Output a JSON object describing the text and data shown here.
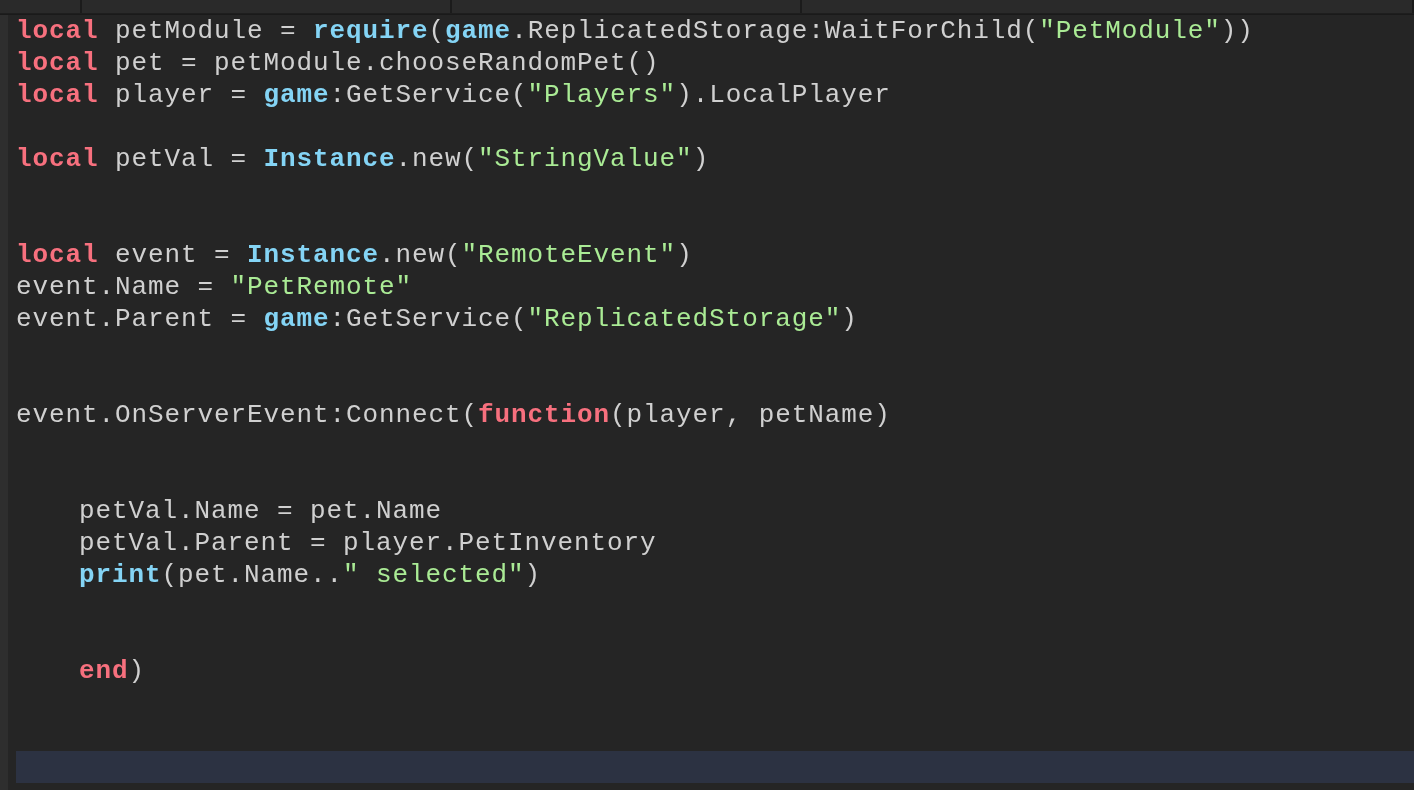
{
  "lines": [
    {
      "kind": "code",
      "current": false,
      "tokens": [
        {
          "kind": "kw",
          "s": "local"
        },
        {
          "kind": "p",
          "s": " petModule = "
        },
        {
          "kind": "bi",
          "s": "require"
        },
        {
          "kind": "p",
          "s": "("
        },
        {
          "kind": "bi",
          "s": "game"
        },
        {
          "kind": "p",
          "s": ".ReplicatedStorage:WaitForChild("
        },
        {
          "kind": "str",
          "s": "\"PetModule\""
        },
        {
          "kind": "p",
          "s": "))"
        }
      ]
    },
    {
      "kind": "code",
      "current": false,
      "tokens": [
        {
          "kind": "kw",
          "s": "local"
        },
        {
          "kind": "p",
          "s": " pet = petModule.chooseRandomPet()"
        }
      ]
    },
    {
      "kind": "code",
      "current": false,
      "tokens": [
        {
          "kind": "kw",
          "s": "local"
        },
        {
          "kind": "p",
          "s": " player = "
        },
        {
          "kind": "bi",
          "s": "game"
        },
        {
          "kind": "p",
          "s": ":GetService("
        },
        {
          "kind": "str",
          "s": "\"Players\""
        },
        {
          "kind": "p",
          "s": ").LocalPlayer"
        }
      ]
    },
    {
      "kind": "blank",
      "current": false
    },
    {
      "kind": "code",
      "current": false,
      "tokens": [
        {
          "kind": "kw",
          "s": "local"
        },
        {
          "kind": "p",
          "s": " petVal = "
        },
        {
          "kind": "bi",
          "s": "Instance"
        },
        {
          "kind": "p",
          "s": ".new("
        },
        {
          "kind": "str",
          "s": "\"StringValue\""
        },
        {
          "kind": "p",
          "s": ")"
        }
      ]
    },
    {
      "kind": "blank",
      "current": false
    },
    {
      "kind": "blank",
      "current": false
    },
    {
      "kind": "code",
      "current": false,
      "tokens": [
        {
          "kind": "kw",
          "s": "local"
        },
        {
          "kind": "p",
          "s": " event = "
        },
        {
          "kind": "bi",
          "s": "Instance"
        },
        {
          "kind": "p",
          "s": ".new("
        },
        {
          "kind": "str",
          "s": "\"RemoteEvent\""
        },
        {
          "kind": "p",
          "s": ")"
        }
      ]
    },
    {
      "kind": "code",
      "current": false,
      "tokens": [
        {
          "kind": "p",
          "s": "event.Name = "
        },
        {
          "kind": "str",
          "s": "\"PetRemote\""
        }
      ]
    },
    {
      "kind": "code",
      "current": false,
      "tokens": [
        {
          "kind": "p",
          "s": "event.Parent = "
        },
        {
          "kind": "bi",
          "s": "game"
        },
        {
          "kind": "p",
          "s": ":GetService("
        },
        {
          "kind": "str",
          "s": "\"ReplicatedStorage\""
        },
        {
          "kind": "p",
          "s": ")"
        }
      ]
    },
    {
      "kind": "blank",
      "current": false
    },
    {
      "kind": "blank",
      "current": false
    },
    {
      "kind": "code",
      "current": false,
      "tokens": [
        {
          "kind": "p",
          "s": "event.OnServerEvent:Connect("
        },
        {
          "kind": "kw",
          "s": "function"
        },
        {
          "kind": "p",
          "s": "(player, petName)"
        }
      ],
      "children": [
        {
          "kind": "blank",
          "current": false
        },
        {
          "kind": "blank",
          "current": false
        },
        {
          "kind": "code",
          "current": false,
          "tokens": [
            {
              "kind": "p",
              "s": "petVal.Name = pet.Name"
            }
          ]
        },
        {
          "kind": "code",
          "current": false,
          "tokens": [
            {
              "kind": "p",
              "s": "petVal.Parent = player.PetInventory"
            }
          ]
        },
        {
          "kind": "code",
          "current": false,
          "tokens": [
            {
              "kind": "bi",
              "s": "print"
            },
            {
              "kind": "p",
              "s": "(pet.Name.."
            },
            {
              "kind": "str",
              "s": "\" selected\""
            },
            {
              "kind": "p",
              "s": ")"
            }
          ]
        },
        {
          "kind": "blank",
          "current": false
        },
        {
          "kind": "blank",
          "current": false
        },
        {
          "kind": "code",
          "current": false,
          "tokens": [
            {
              "kind": "kw",
              "s": "end"
            },
            {
              "kind": "p",
              "s": ")"
            }
          ]
        }
      ]
    },
    {
      "kind": "blank",
      "current": false
    },
    {
      "kind": "blank",
      "current": false
    },
    {
      "kind": "blank",
      "current": true
    }
  ]
}
